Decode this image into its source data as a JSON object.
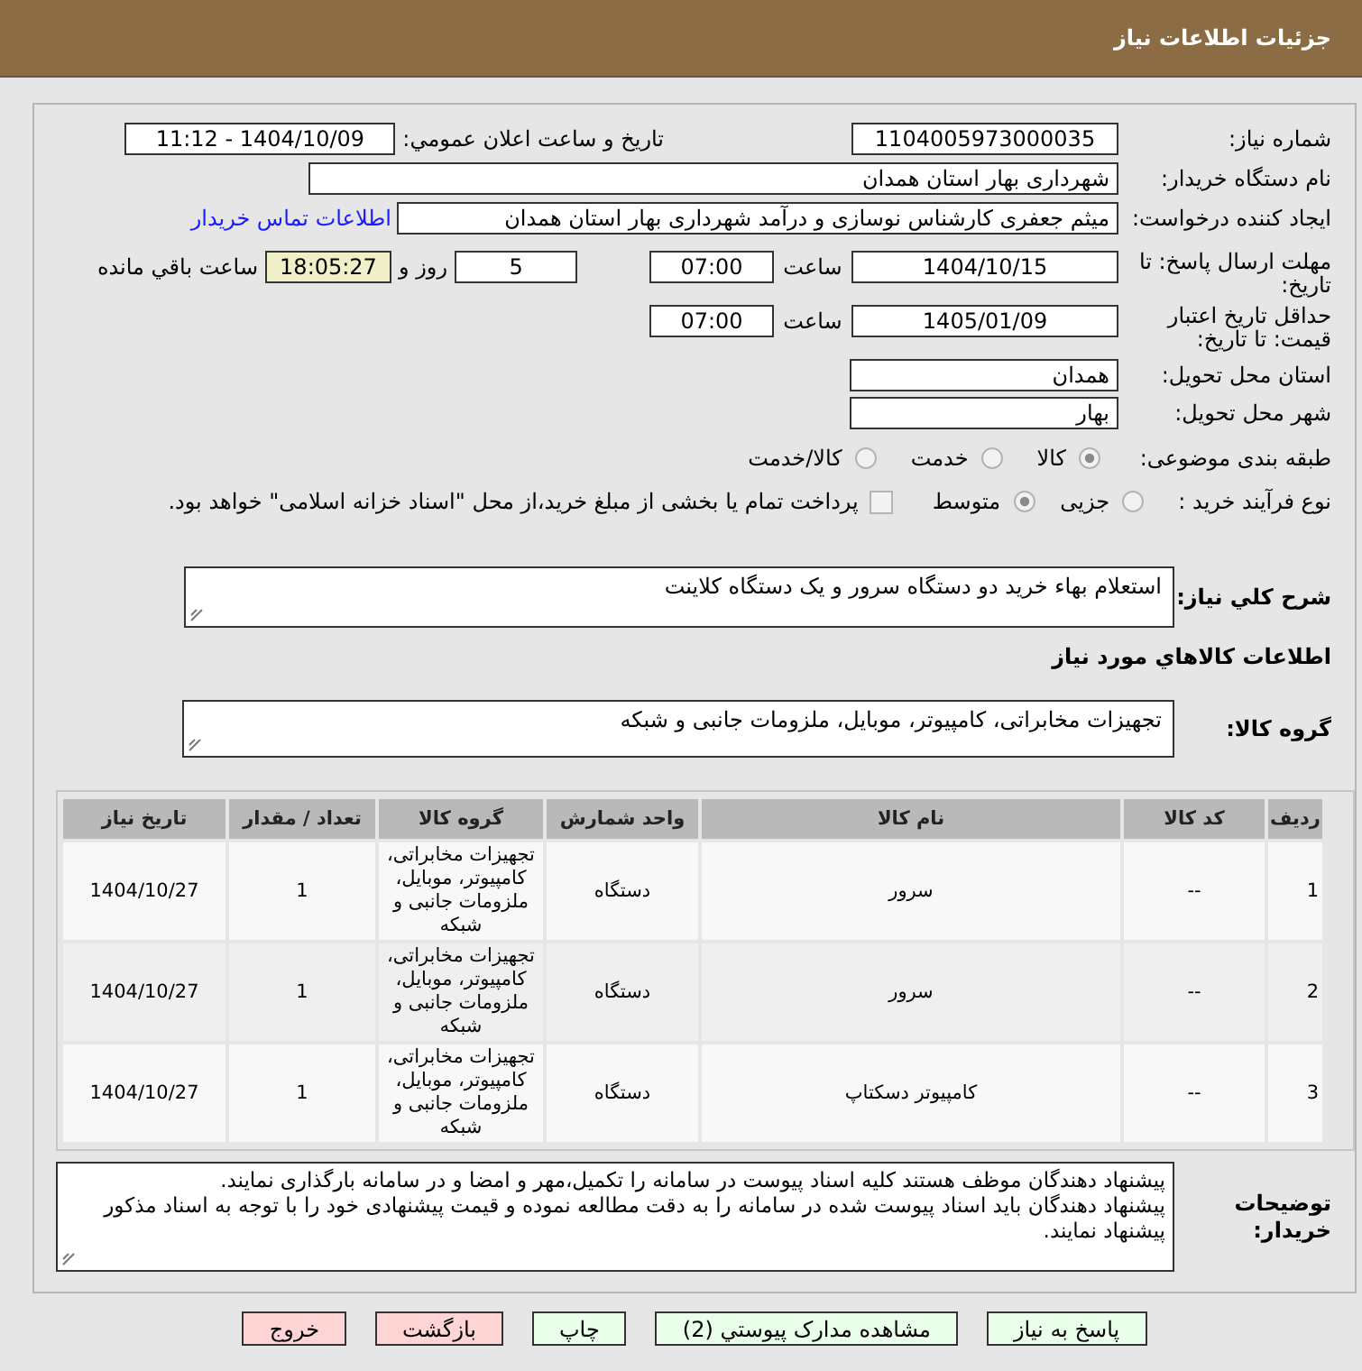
{
  "header": {
    "title": "جزئیات اطلاعات نیاز"
  },
  "form": {
    "need_number": {
      "label": "شماره نیاز:",
      "value": "1104005973000035"
    },
    "announce_date": {
      "label": "تاریخ و ساعت اعلان عمومي:",
      "value": "1404/10/09 - 11:12"
    },
    "buyer_org": {
      "label": "نام دستگاه خریدار:",
      "value": "شهرداری بهار استان همدان"
    },
    "requester": {
      "label": "ایجاد کننده درخواست:",
      "value": "میثم جعفری کارشناس نوسازی و درآمد شهرداری بهار استان همدان",
      "contact_link": "اطلاعات تماس خریدار"
    },
    "reply_deadline": {
      "label": "مهلت ارسال پاسخ: تا تاریخ:",
      "date": "1404/10/15",
      "time_label": "ساعت",
      "time": "07:00",
      "days": "5",
      "days_label": "روز و",
      "remaining": "18:05:27",
      "remaining_label": "ساعت باقي مانده"
    },
    "price_validity": {
      "label": "حداقل تاریخ اعتبار قیمت: تا تاریخ:",
      "date": "1405/01/09",
      "time_label": "ساعت",
      "time": "07:00"
    },
    "delivery_province": {
      "label": "استان محل تحویل:",
      "value": "همدان"
    },
    "delivery_city": {
      "label": "شهر محل تحویل:",
      "value": "بهار"
    },
    "subject_category": {
      "label": "طبقه بندی موضوعی:",
      "options": [
        {
          "label": "کالا",
          "selected": true
        },
        {
          "label": "خدمت",
          "selected": false
        },
        {
          "label": "کالا/خدمت",
          "selected": false
        }
      ]
    },
    "purchase_process": {
      "label": "نوع فرآیند خرید :",
      "options": [
        {
          "label": "جزیی",
          "selected": false
        },
        {
          "label": "متوسط",
          "selected": true
        }
      ],
      "treasury_payment": {
        "checked": false,
        "label": "پرداخت تمام یا بخشی از مبلغ خرید،از محل \"اسناد خزانه اسلامی\" خواهد بود."
      }
    }
  },
  "description": {
    "label": "شرح کلي نیاز:",
    "value": "استعلام بهاء خرید دو دستگاه سرور و یک دستگاه کلاینت"
  },
  "goods": {
    "title": "اطلاعات کالاهاي مورد نیاز",
    "group_label": "گروه کالا:",
    "group_value": "تجهیزات مخابراتی، کامپیوتر، موبایل، ملزومات جانبی و شبکه",
    "table": {
      "columns": [
        "ردیف",
        "کد کالا",
        "نام کالا",
        "واحد شمارش",
        "گروه کالا",
        "تعداد / مقدار",
        "تاریخ نیاز"
      ],
      "rows": [
        [
          "1",
          "--",
          "سرور",
          "دستگاه",
          "تجهیزات مخابراتی، کامپیوتر، موبایل، ملزومات جانبی و شبکه",
          "1",
          "1404/10/27"
        ],
        [
          "2",
          "--",
          "سرور",
          "دستگاه",
          "تجهیزات مخابراتی، کامپیوتر، موبایل، ملزومات جانبی و شبکه",
          "1",
          "1404/10/27"
        ],
        [
          "3",
          "--",
          "کامپیوتر دسکتاپ",
          "دستگاه",
          "تجهیزات مخابراتی، کامپیوتر، موبایل، ملزومات جانبی و شبکه",
          "1",
          "1404/10/27"
        ]
      ]
    }
  },
  "buyer_notes": {
    "label": "توضیحات خریدار:",
    "value": "پیشنهاد دهندگان موظف هستند کلیه اسناد پیوست در سامانه را تکمیل،مهر و امضا و در سامانه بارگذاری نمایند.\nپیشنهاد دهندگان باید اسناد پیوست شده در سامانه را به دقت مطالعه نموده و قیمت پیشنهادی خود را با توجه به اسناد مذکور پیشنهاد نمایند."
  },
  "buttons": [
    {
      "label": "پاسخ به نیاز",
      "kind": "action"
    },
    {
      "label": "مشاهده مدارک پیوستي (2)",
      "kind": "action"
    },
    {
      "label": "چاپ",
      "kind": "action"
    },
    {
      "label": "بازگشت",
      "kind": "exit"
    },
    {
      "label": "خروج",
      "kind": "exit"
    }
  ]
}
